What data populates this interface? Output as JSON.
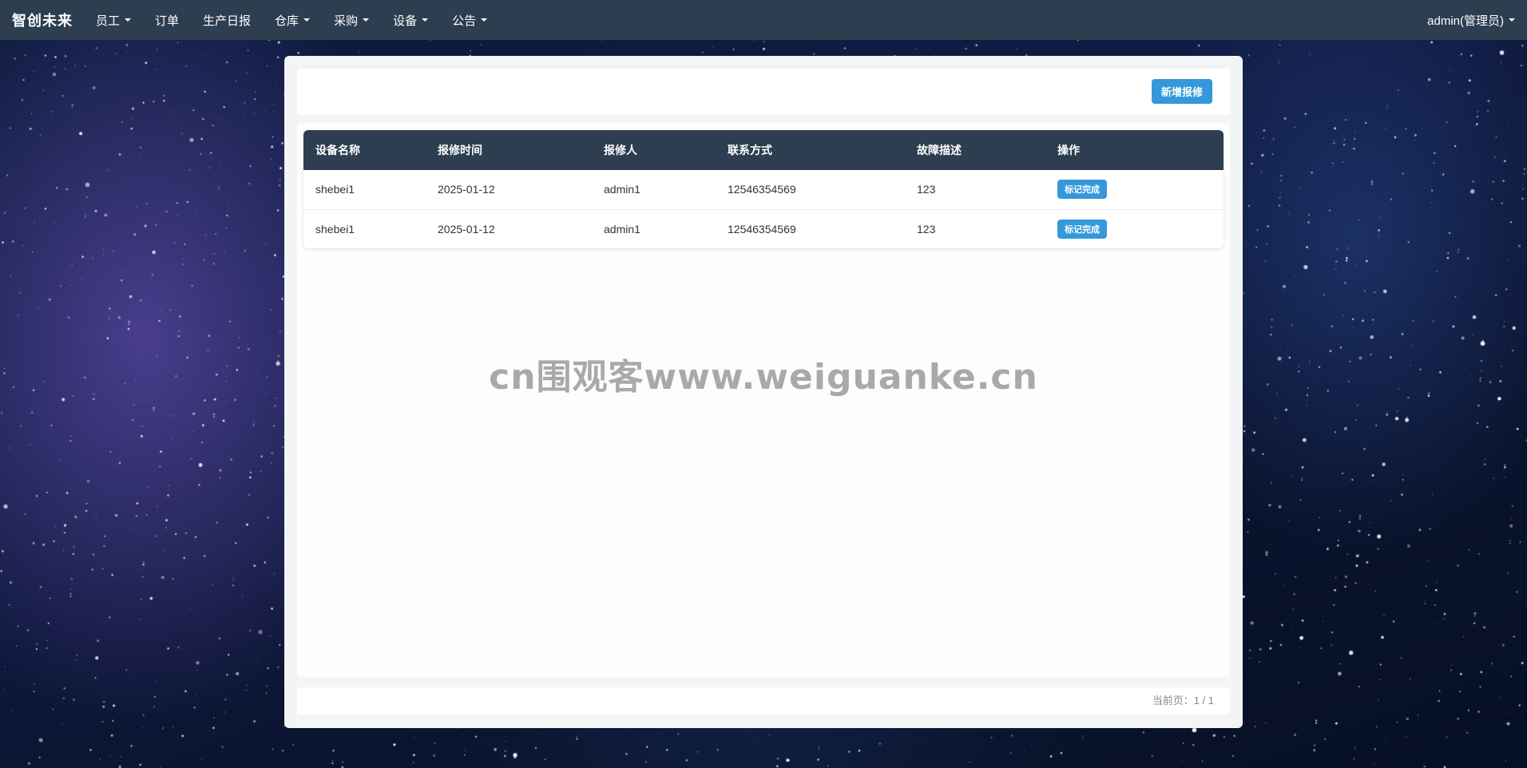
{
  "navbar": {
    "brand": "智创未来",
    "items": [
      {
        "label": "员工",
        "dropdown": true
      },
      {
        "label": "订单",
        "dropdown": false
      },
      {
        "label": "生产日报",
        "dropdown": false
      },
      {
        "label": "仓库",
        "dropdown": true
      },
      {
        "label": "采购",
        "dropdown": true
      },
      {
        "label": "设备",
        "dropdown": true
      },
      {
        "label": "公告",
        "dropdown": true
      }
    ],
    "user": "admin(管理员)"
  },
  "toolbar": {
    "add_repair_label": "新增报修"
  },
  "table": {
    "columns": [
      "设备名称",
      "报修时间",
      "报修人",
      "联系方式",
      "故障描述",
      "操作"
    ],
    "rows": [
      {
        "device": "shebei1",
        "time": "2025-01-12",
        "reporter": "admin1",
        "contact": "12546354569",
        "description": "123",
        "action": "标记完成"
      },
      {
        "device": "shebei1",
        "time": "2025-01-12",
        "reporter": "admin1",
        "contact": "12546354569",
        "description": "123",
        "action": "标记完成"
      }
    ]
  },
  "watermark": "cn围观客www.weiguanke.cn",
  "pagination": {
    "label": "当前页：1 / 1"
  },
  "colors": {
    "navbar": "#2c3e50",
    "accent": "#3498db"
  }
}
